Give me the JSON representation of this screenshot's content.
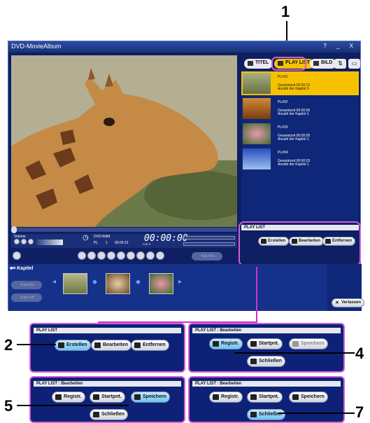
{
  "callouts": [
    "1",
    "2",
    "4",
    "5",
    "7"
  ],
  "window": {
    "title": "DVD-MovieAlbum",
    "controls": "? _ X"
  },
  "tabs": [
    {
      "label": "TITEL",
      "icon": "film-icon",
      "selected": false
    },
    {
      "label": "PLAY LIST",
      "icon": "playlist-icon",
      "selected": true
    },
    {
      "label": "BILD",
      "icon": "picture-icon",
      "selected": false
    }
  ],
  "playlist_items": [
    {
      "name": "PL#01",
      "duration": "Gesamtzeit 00:00:13",
      "chapters": "Anzahl der Kapitel  3",
      "selected": true
    },
    {
      "name": "PL#02",
      "duration": "Gesamtzeit 00:00:05",
      "chapters": "Anzahl der Kapitel  1",
      "selected": false
    },
    {
      "name": "PL#03",
      "duration": "Gesamtzeit 00:00:05",
      "chapters": "Anzahl der Kapitel  1",
      "selected": false
    },
    {
      "name": "PL#04",
      "duration": "Gesamtzeit 00:00:03",
      "chapters": "Anzahl der Kapitel  1",
      "selected": false
    }
  ],
  "player": {
    "volume_label": "Volume",
    "disc_type": "DVD-RAM",
    "pl_label": "PL",
    "pl_number": "1",
    "small_time": "00:00:13",
    "time_display": "00:00:00",
    "hms_label": "H    M    S",
    "chapter_btn": "Kap.hinz"
  },
  "chapter_strip": {
    "label": "Kapitel",
    "btn1": "Kap.hinz",
    "btn2": "Kap.entf",
    "exit_button": "Verlassen"
  },
  "main_panel": {
    "header": "PLAY LIST",
    "buttons": [
      "Erstellen",
      "Bearbeiten",
      "Entfernen"
    ]
  },
  "panels": [
    {
      "header": "PLAY LIST",
      "buttons": [
        "Erstellen",
        "Bearbeiten",
        "Entfernen"
      ],
      "highlighted": "Erstellen"
    },
    {
      "header": "PLAY LIST : Bearbeiten",
      "buttons": [
        "Registr.",
        "Startpnt.",
        "Speichern",
        "Schließen"
      ],
      "highlighted": "Registr."
    },
    {
      "header": "PLAY LIST : Bearbeiten",
      "buttons": [
        "Registr.",
        "Startpnt.",
        "Speichern",
        "Schließen"
      ],
      "highlighted": "Speichern"
    },
    {
      "header": "PLAY LIST : Bearbeiten",
      "buttons": [
        "Registr.",
        "Startpnt.",
        "Speichern",
        "Schließen"
      ],
      "highlighted": "Schließen"
    }
  ],
  "colors": {
    "window_bg": "#0e1f63",
    "selected_item": "#f6c200",
    "callout_border": "#d45fd6",
    "highlight_button": "#6cc2f0"
  }
}
